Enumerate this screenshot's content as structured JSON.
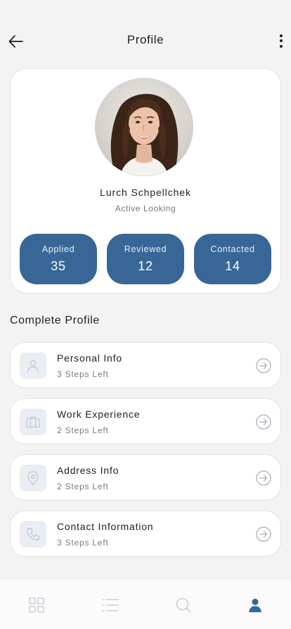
{
  "header": {
    "title": "Profile",
    "back_icon": "arrow-left-icon",
    "menu_icon": "more-vertical-icon"
  },
  "profile": {
    "name": "Lurch Schpellchek",
    "status": "Active Looking",
    "stats": [
      {
        "label": "Applied",
        "value": "35"
      },
      {
        "label": "Reviewed",
        "value": "12"
      },
      {
        "label": "Contacted",
        "value": "14"
      }
    ]
  },
  "complete_profile": {
    "title": "Complete Profile",
    "items": [
      {
        "title": "Personal Info",
        "subtitle": "3 Steps Left",
        "icon": "user-icon"
      },
      {
        "title": "Work Experience",
        "subtitle": "2 Steps Left",
        "icon": "briefcase-icon"
      },
      {
        "title": "Address Info",
        "subtitle": "2 Steps Left",
        "icon": "map-pin-icon"
      },
      {
        "title": "Contact Information",
        "subtitle": "3 Steps Left",
        "icon": "phone-icon"
      }
    ]
  },
  "bottom_nav": {
    "items": [
      "grid-icon",
      "list-icon",
      "search-icon",
      "profile-icon"
    ],
    "active": "profile-icon"
  },
  "colors": {
    "accent": "#386797",
    "icon_muted": "#c7cfd9",
    "icon_tile": "#e9eef4",
    "background": "#f3f3f3"
  }
}
